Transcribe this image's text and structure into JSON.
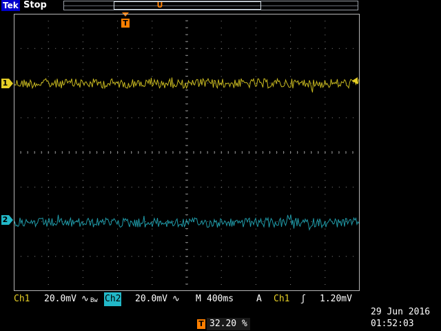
{
  "topbar": {
    "brand": "Tek",
    "status": "Stop",
    "record_trigger_glyph": "U"
  },
  "trigger_marker": {
    "label": "T"
  },
  "channels": {
    "ch1": {
      "marker": "1",
      "color": "#e6cf26"
    },
    "ch2": {
      "marker": "2",
      "color": "#22b8c8"
    }
  },
  "readout": {
    "ch1_label": "Ch1",
    "ch1_scale": "20.0mV",
    "ch1_coupling": "∿",
    "ch1_bw": "Bw",
    "ch2_label": "Ch2",
    "ch2_scale": "20.0mV",
    "ch2_coupling": "∿",
    "timebase_label": "M",
    "timebase_value": "400ms",
    "trigger_mode": "A",
    "trigger_source": "Ch1",
    "trigger_slope_icon": "rising-edge-icon",
    "trigger_slope": "ʃ",
    "trigger_level": "1.20mV"
  },
  "trigger_position": {
    "label": "T",
    "value": "32.20 %"
  },
  "datetime": {
    "date": "29 Jun  2016",
    "time": "01:52:03"
  },
  "colors": {
    "accent_orange": "#ff7f00",
    "brand_blue": "#0000cc",
    "grid": "#8a8a8a"
  }
}
